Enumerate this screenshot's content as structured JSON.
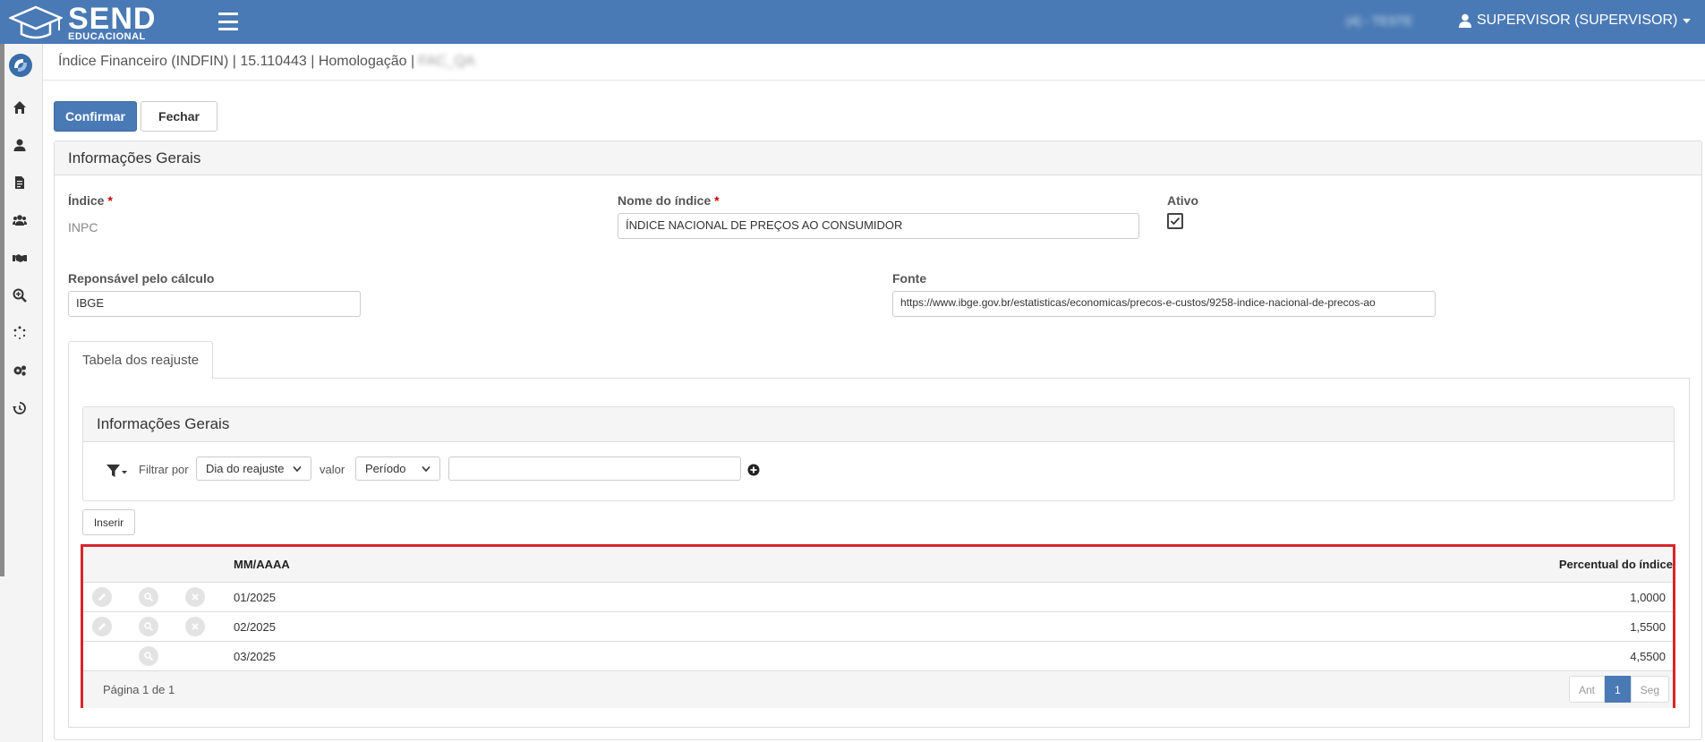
{
  "app": {
    "logo_main": "SEND",
    "logo_sub": "EDUCACIONAL",
    "environment": "(4) - TESTE",
    "user_label": "SUPERVISOR (SUPERVISOR)"
  },
  "breadcrumb": {
    "text": "Índice Financeiro (INDFIN) | 15.110443 | Homologação |",
    "blurred": "FAC_QA"
  },
  "actions": {
    "confirm": "Confirmar",
    "close": "Fechar"
  },
  "general": {
    "title": "Informações Gerais",
    "index_label": "Índice",
    "index_value": "INPC",
    "name_label": "Nome do índice",
    "name_value": "ÍNDICE NACIONAL DE PREÇOS AO CONSUMIDOR",
    "active_label": "Ativo",
    "responsible_label": "Reponsável pelo cálculo",
    "responsible_value": "IBGE",
    "source_label": "Fonte",
    "source_value": "https://www.ibge.gov.br/estatisticas/economicas/precos-e-custos/9258-indice-nacional-de-precos-ao",
    "required_mark": "*"
  },
  "tab": {
    "label": "Tabela dos reajuste"
  },
  "filter_panel": {
    "title": "Informações Gerais",
    "filter_by": "Filtrar por",
    "field_select": "Dia do reajuste",
    "value_label": "valor",
    "period_select": "Período",
    "value_input": ""
  },
  "insert_button": "Inserir",
  "table": {
    "headers": {
      "period": "MM/AAAA",
      "percent": "Percentual do índice"
    },
    "rows": [
      {
        "period": "01/2025",
        "percent": "1,0000"
      },
      {
        "period": "02/2025",
        "percent": "1,5500"
      },
      {
        "period": "03/2025",
        "percent": "4,5500"
      }
    ],
    "page_info": "Página 1 de 1",
    "prev": "Ant",
    "page": "1",
    "next": "Seg"
  },
  "icons": {
    "sidebar": [
      "home-icon",
      "user-icon",
      "document-icon",
      "users-icon",
      "handshake-icon",
      "search-icon",
      "spinner-icon",
      "gears-icon",
      "history-icon"
    ]
  },
  "colors": {
    "topbar": "#4a7ab5",
    "highlight_border": "#d8262a"
  }
}
